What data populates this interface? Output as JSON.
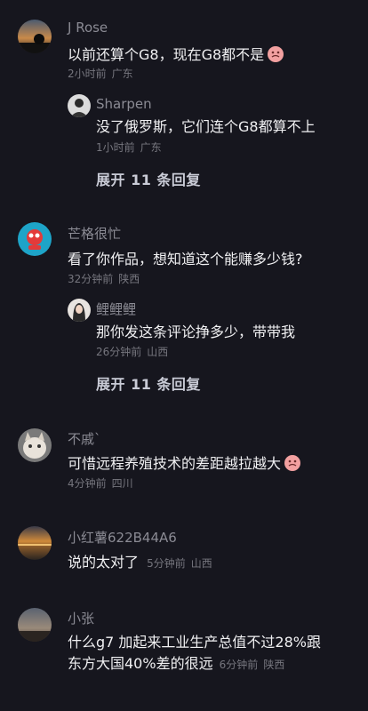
{
  "comments": [
    {
      "name": "J Rose",
      "text": "以前还算个G8，现在G8都不是",
      "time": "2小时前",
      "location": "广东",
      "reply": {
        "name": "Sharpen",
        "text": "没了俄罗斯，它们连个G8都算不上",
        "time": "1小时前",
        "location": "广东"
      },
      "expand": "展开 11 条回复"
    },
    {
      "name": "芒格很忙",
      "text": "看了你作品，想知道这个能赚多少钱?",
      "time": "32分钟前",
      "location": "陕西",
      "reply": {
        "name": "鲤鲤鲤",
        "text": "那你发这条评论挣多少，带带我",
        "time": "26分钟前",
        "location": "山西"
      },
      "expand": "展开 11 条回复"
    },
    {
      "name": "不戚`",
      "text": "可惜远程养殖技术的差距越拉越大",
      "time": "4分钟前",
      "location": "四川"
    },
    {
      "name": "小红薯622B44A6",
      "text": "说的太对了",
      "time": "5分钟前",
      "location": "山西"
    },
    {
      "name": "小张",
      "text_line1": "什么g7 加起来工业生产总值不过28%跟",
      "text_line2": "东方大国40%差的很远",
      "time": "6分钟前",
      "location": "陕西"
    }
  ],
  "colors": {
    "background": "#16161e",
    "name": "#8b8b94",
    "meta": "#76767e",
    "expand": "#c9cbd6"
  }
}
